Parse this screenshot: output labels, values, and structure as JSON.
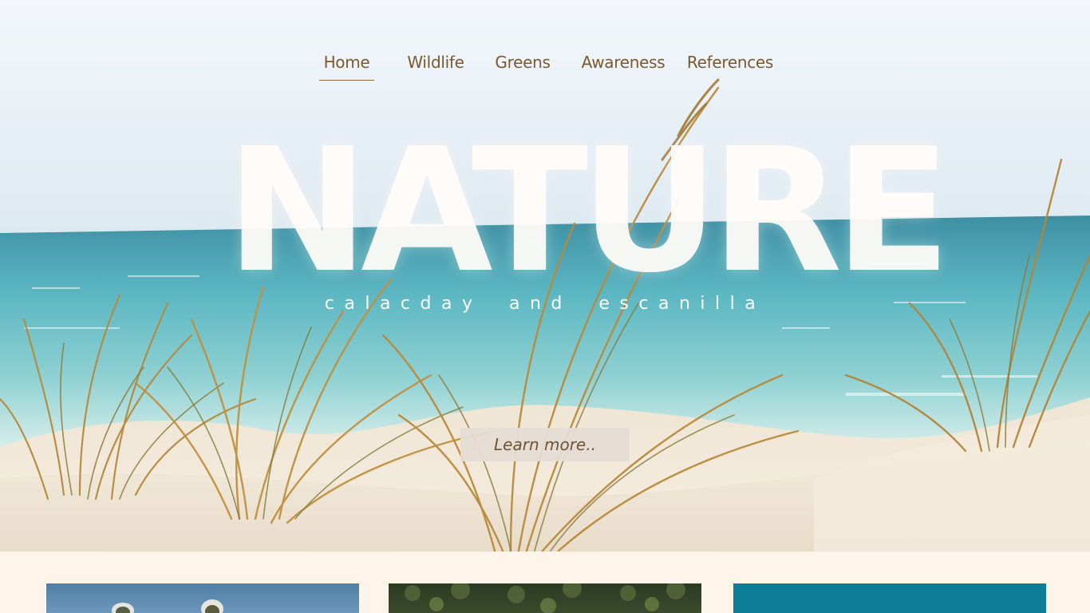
{
  "nav": {
    "items": [
      {
        "label": "Home",
        "active": true
      },
      {
        "label": "Wildlife",
        "active": false
      },
      {
        "label": "Greens",
        "active": false
      },
      {
        "label": "Awareness",
        "active": false
      },
      {
        "label": "References",
        "active": false
      }
    ]
  },
  "hero": {
    "title": "NATURE",
    "subtitle": "calacday and escanilla",
    "cta_label": "Learn more.."
  },
  "colors": {
    "nav_text": "#7a5a2e",
    "page_background": "#fdf5ea",
    "cta_background": "#e4ddd4",
    "cta_text": "#6f5333"
  }
}
